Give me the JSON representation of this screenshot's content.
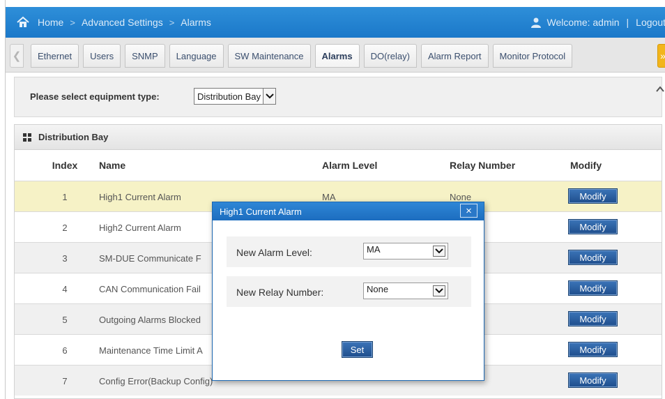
{
  "breadcrumb": {
    "home": "Home",
    "section": "Advanced Settings",
    "page": "Alarms",
    "separator": ">"
  },
  "user": {
    "welcome": "Welcome:  admin",
    "separator": "|",
    "logout": "Logout"
  },
  "tabs": [
    {
      "label": "Ethernet"
    },
    {
      "label": "Users"
    },
    {
      "label": "SNMP"
    },
    {
      "label": "Language"
    },
    {
      "label": "SW Maintenance"
    },
    {
      "label": "Alarms",
      "active": true
    },
    {
      "label": "DO(relay)"
    },
    {
      "label": "Alarm Report"
    },
    {
      "label": "Monitor Protocol"
    }
  ],
  "selector": {
    "label": "Please select equipment type:",
    "value": "Distribution Bay"
  },
  "panel": {
    "title": "Distribution Bay",
    "columns": {
      "index": "Index",
      "name": "Name",
      "level": "Alarm Level",
      "relay": "Relay Number",
      "modify": "Modify"
    },
    "rows": [
      {
        "index": "1",
        "name": "High1 Current Alarm",
        "level": "MA",
        "relay": "None",
        "modify": "Modify"
      },
      {
        "index": "2",
        "name": "High2 Current Alarm",
        "level": "",
        "relay": "",
        "modify": "Modify"
      },
      {
        "index": "3",
        "name": "SM-DUE Communicate F",
        "level": "",
        "relay": "",
        "modify": "Modify"
      },
      {
        "index": "4",
        "name": "CAN Communication Fail",
        "level": "",
        "relay": "",
        "modify": "Modify"
      },
      {
        "index": "5",
        "name": "Outgoing Alarms Blocked",
        "level": "",
        "relay": "",
        "modify": "Modify"
      },
      {
        "index": "6",
        "name": "Maintenance Time Limit A",
        "level": "",
        "relay": "",
        "modify": "Modify"
      },
      {
        "index": "7",
        "name": "Config Error(Backup Config)",
        "level": "",
        "relay": "",
        "modify": "Modify"
      }
    ]
  },
  "modal": {
    "title": "High1 Current Alarm",
    "close": "×",
    "level_label": "New Alarm Level:",
    "level_value": "MA",
    "relay_label": "New Relay Number:",
    "relay_value": "None",
    "set": "Set"
  },
  "colors": {
    "topbar": "#1b78c9",
    "button": "#1f4e8c",
    "highlight_row": "#f6f2c6",
    "next_arrow": "#f2b51c"
  },
  "icons": {
    "home": "home-icon",
    "user": "user-icon",
    "grid": "grid-icon",
    "dropdown": "chevron-down-icon",
    "close": "close-icon"
  }
}
